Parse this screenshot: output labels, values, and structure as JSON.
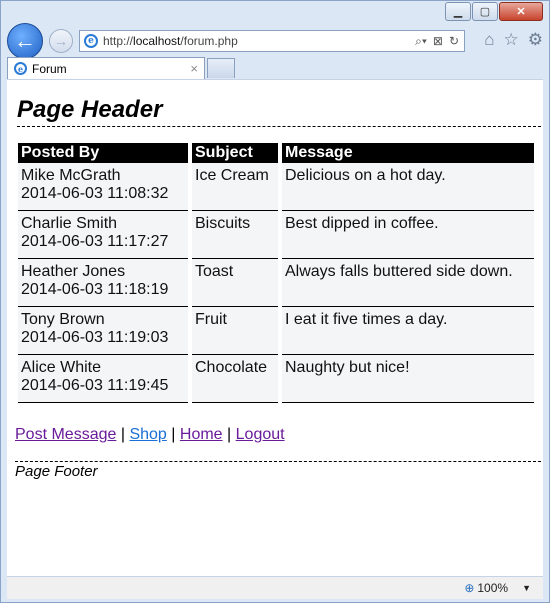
{
  "browser": {
    "address_url_prefix": "http://",
    "address_host": "localhost",
    "address_path": "/forum.php",
    "tab_title": "Forum",
    "tab_close": "×",
    "zoom": "100%"
  },
  "page": {
    "header": "Page Header",
    "footer": "Page Footer",
    "table": {
      "columns": [
        "Posted By",
        "Subject",
        "Message"
      ],
      "rows": [
        {
          "name": "Mike McGrath",
          "time": "2014-06-03 11:08:32",
          "subject": "Ice Cream",
          "message": "Delicious on a hot day."
        },
        {
          "name": "Charlie Smith",
          "time": "2014-06-03 11:17:27",
          "subject": "Biscuits",
          "message": "Best dipped in coffee."
        },
        {
          "name": "Heather Jones",
          "time": "2014-06-03 11:18:19",
          "subject": "Toast",
          "message": "Always falls buttered side down."
        },
        {
          "name": "Tony Brown",
          "time": "2014-06-03 11:19:03",
          "subject": "Fruit",
          "message": "I eat it five times a day."
        },
        {
          "name": "Alice White",
          "time": "2014-06-03 11:19:45",
          "subject": "Chocolate",
          "message": "Naughty but nice!"
        }
      ]
    },
    "links": [
      "Post Message",
      "Shop",
      "Home",
      "Logout"
    ],
    "link_separator": "|"
  }
}
